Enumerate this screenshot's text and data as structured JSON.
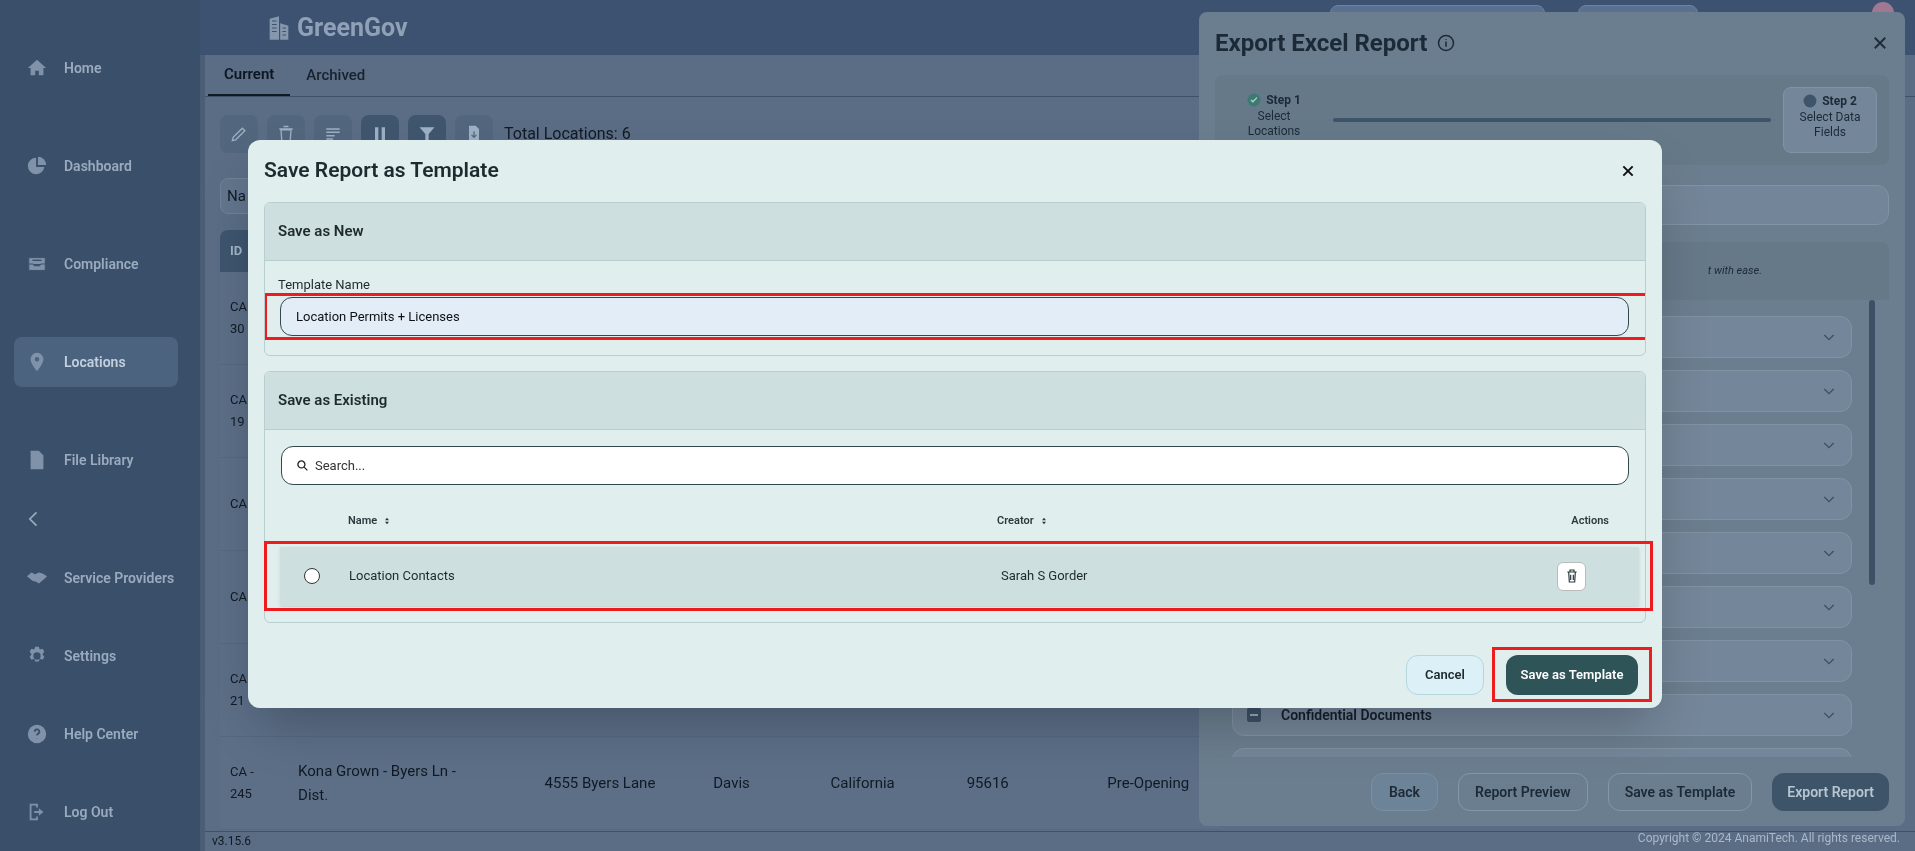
{
  "app": {
    "logo": "GreenGov",
    "version": "v3.15.6"
  },
  "sidebar": {
    "items": [
      {
        "label": "Home",
        "selected": false
      },
      {
        "label": "Dashboard",
        "selected": false
      },
      {
        "label": "Compliance",
        "selected": false
      },
      {
        "label": "Locations",
        "selected": true
      },
      {
        "label": "File Library",
        "selected": false
      },
      {
        "label": "Service Providers",
        "selected": false
      },
      {
        "label": "Settings",
        "selected": false
      },
      {
        "label": "Help Center",
        "selected": false
      },
      {
        "label": "Log Out",
        "selected": false
      }
    ]
  },
  "tabs": [
    {
      "label": "Current",
      "selected": true
    },
    {
      "label": "Archived",
      "selected": false
    }
  ],
  "toolbar": {
    "total": "Total Locations: 6"
  },
  "search": {
    "placeholder": "Na"
  },
  "table": {
    "header": "ID",
    "rows": [
      {
        "id": [
          "CA",
          "30"
        ]
      },
      {
        "id": [
          "CA",
          "19"
        ]
      },
      {
        "id": [
          "CA"
        ]
      },
      {
        "id": [
          "CA"
        ]
      },
      {
        "id": [
          "CA",
          "21"
        ]
      },
      {
        "id": [
          "CA -",
          "245"
        ],
        "cells": [
          "Kona Grown - Byers Ln - Dist.",
          "4555 Byers Lane",
          "Davis",
          "California",
          "95616",
          "Pre-Opening"
        ]
      }
    ]
  },
  "export": {
    "title": "Export Excel Report",
    "steps": [
      {
        "label": "Step 1",
        "sub": "Select Locations",
        "done": true
      },
      {
        "label": "Step 2",
        "sub": "Select Data Fields",
        "done": false
      }
    ],
    "hint": "t with ease.",
    "groups": [
      {
        "label": "Confidential Documents",
        "indeterminate": true
      }
    ],
    "buttons": [
      {
        "label": "Back",
        "kind": "muted"
      },
      {
        "label": "Report Preview",
        "kind": "outline"
      },
      {
        "label": "Save as Template",
        "kind": "outline"
      },
      {
        "label": "Export Report",
        "kind": "primary"
      }
    ],
    "copyright": "Copyright © 2024 AnamiTech. All rights reserved."
  },
  "dialog": {
    "title": "Save Report as Template",
    "new": {
      "heading": "Save as New",
      "label": "Template Name",
      "value": "Location Permits + Licenses",
      "highlighted": true
    },
    "existing": {
      "heading": "Save as Existing",
      "search_placeholder": "Search...",
      "columns": [
        {
          "label": "Name",
          "sortable": true
        },
        {
          "label": "Creator",
          "sortable": true
        },
        {
          "label": "Actions",
          "sortable": false
        }
      ],
      "rows": [
        {
          "name": "Location Contacts",
          "creator": "Sarah S Gorder",
          "selected": false,
          "highlighted": true
        }
      ]
    },
    "buttons": [
      {
        "label": "Cancel",
        "kind": "secondary",
        "highlighted": false
      },
      {
        "label": "Save as Template",
        "kind": "primary",
        "highlighted": true
      }
    ]
  }
}
